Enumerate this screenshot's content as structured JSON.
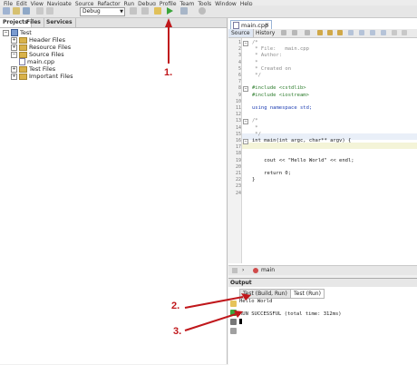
{
  "menu": [
    "File",
    "Edit",
    "View",
    "Navigate",
    "Source",
    "Refactor",
    "Run",
    "Debug",
    "Profile",
    "Team",
    "Tools",
    "Window",
    "Help"
  ],
  "toolbar": {
    "config_value": "Debug"
  },
  "projects": {
    "tabs": [
      "Projects",
      "Files",
      "Services"
    ],
    "tree": [
      {
        "label": "Test",
        "indent": 0,
        "kind": "project"
      },
      {
        "label": "Header Files",
        "indent": 1,
        "kind": "folder"
      },
      {
        "label": "Resource Files",
        "indent": 1,
        "kind": "folder"
      },
      {
        "label": "Source Files",
        "indent": 1,
        "kind": "folder"
      },
      {
        "label": "main.cpp",
        "indent": 2,
        "kind": "file"
      },
      {
        "label": "Test Files",
        "indent": 1,
        "kind": "folder"
      },
      {
        "label": "Important Files",
        "indent": 1,
        "kind": "folder"
      }
    ]
  },
  "editor": {
    "tab": "main.cpp",
    "modes": [
      "Source",
      "History"
    ],
    "lines": [
      {
        "n": "1",
        "text": "/*",
        "cls": "cmt"
      },
      {
        "n": "2",
        "text": " * File:   main.cpp",
        "cls": "cmt"
      },
      {
        "n": "3",
        "text": " * Author:",
        "cls": "cmt"
      },
      {
        "n": "4",
        "text": " *",
        "cls": "cmt"
      },
      {
        "n": "5",
        "text": " * Created on",
        "cls": "cmt"
      },
      {
        "n": "6",
        "text": " */",
        "cls": "cmt"
      },
      {
        "n": "7",
        "text": "",
        "cls": ""
      },
      {
        "n": "8",
        "text": "#include <cstdlib>",
        "cls": "pp"
      },
      {
        "n": "9",
        "text": "#include <iostream>",
        "cls": "pp"
      },
      {
        "n": "10",
        "text": "",
        "cls": ""
      },
      {
        "n": "11",
        "text": "using namespace std;",
        "cls": "kw"
      },
      {
        "n": "12",
        "text": "",
        "cls": ""
      },
      {
        "n": "13",
        "text": "/*",
        "cls": "cmt"
      },
      {
        "n": "14",
        "text": " *",
        "cls": "cmt"
      },
      {
        "n": "15",
        "text": " */",
        "cls": "cmt"
      },
      {
        "n": "16",
        "text": "int main(int argc, char** argv) {",
        "cls": ""
      },
      {
        "n": "17",
        "text": "",
        "cls": ""
      },
      {
        "n": "18",
        "text": "",
        "cls": ""
      },
      {
        "n": "19",
        "text": "    cout << \"Hello World\" << endl;",
        "cls": ""
      },
      {
        "n": "20",
        "text": "",
        "cls": ""
      },
      {
        "n": "21",
        "text": "    return 0;",
        "cls": ""
      },
      {
        "n": "22",
        "text": "}",
        "cls": ""
      },
      {
        "n": "23",
        "text": "",
        "cls": ""
      },
      {
        "n": "24",
        "text": "",
        "cls": ""
      }
    ]
  },
  "breadcrumb": {
    "function": "main"
  },
  "output": {
    "title": "Output",
    "tabs": [
      "Test (Build, Run)",
      "Test (Run)"
    ],
    "lines": [
      "Hello World",
      "",
      "RUN SUCCESSFUL (total time: 312ms)"
    ]
  },
  "annotations": [
    "1.",
    "2.",
    "3."
  ],
  "colors": {
    "annotation": "#c0171b",
    "play": "#3aa53a"
  }
}
